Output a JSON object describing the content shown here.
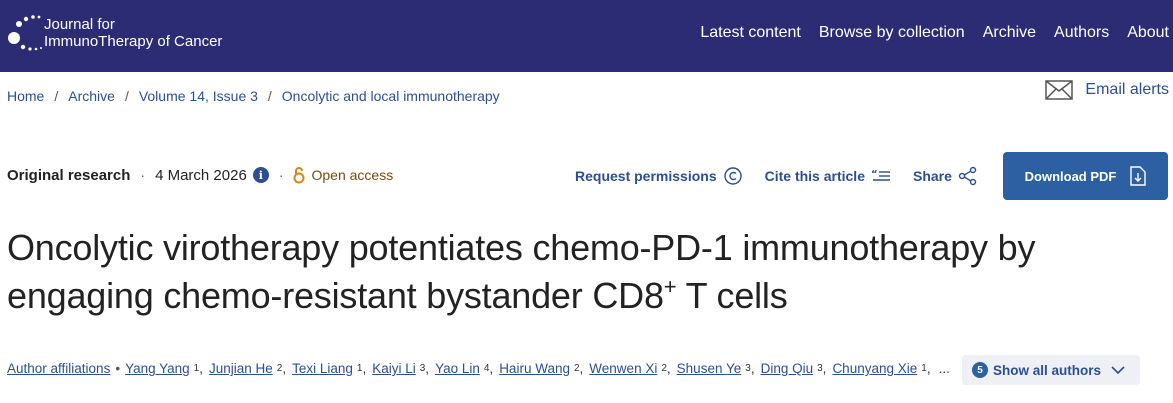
{
  "header": {
    "logo_line1": "Journal for",
    "logo_line2": "ImmunoTherapy of Cancer",
    "nav": [
      "Latest content",
      "Browse by collection",
      "Archive",
      "Authors",
      "About"
    ]
  },
  "breadcrumb": [
    "Home",
    "Archive",
    "Volume 14, Issue 3",
    "Oncolytic and local immunotherapy"
  ],
  "email_alerts": "Email alerts",
  "meta": {
    "article_type": "Original research",
    "date": "4 March 2026",
    "info_icon": "i",
    "open_access": "Open access"
  },
  "actions": {
    "request_permissions": "Request permissions",
    "cite": "Cite this article",
    "share": "Share",
    "download": "Download PDF"
  },
  "title": {
    "line1": "Oncolytic virotherapy potentiates chemo-PD-1 immunotherapy by",
    "line2_before": "engaging chemo-resistant bystander CD8",
    "line2_sup": "+",
    "line2_after": " T cells"
  },
  "authors": {
    "affiliations_label": "Author affiliations",
    "list": [
      {
        "name": "Yang Yang",
        "sup": "1"
      },
      {
        "name": "Junjian He",
        "sup": "2"
      },
      {
        "name": "Texi Liang",
        "sup": "1"
      },
      {
        "name": "Kaiyi Li",
        "sup": "3"
      },
      {
        "name": "Yao Lin",
        "sup": "4"
      },
      {
        "name": "Hairu Wang",
        "sup": "2"
      },
      {
        "name": "Wenwen Xi",
        "sup": "2"
      },
      {
        "name": "Shusen Ye",
        "sup": "3"
      },
      {
        "name": "Ding Qiu",
        "sup": "3"
      },
      {
        "name": "Chunyang Xie",
        "sup": "1"
      }
    ],
    "ellipsis": "...",
    "show_all_count": "5",
    "show_all_label": "Show all authors"
  },
  "colors": {
    "header_bg": "#2c2c75",
    "link": "#2c4f90",
    "button": "#2d5fa3",
    "open_access": "#7a4a10"
  }
}
